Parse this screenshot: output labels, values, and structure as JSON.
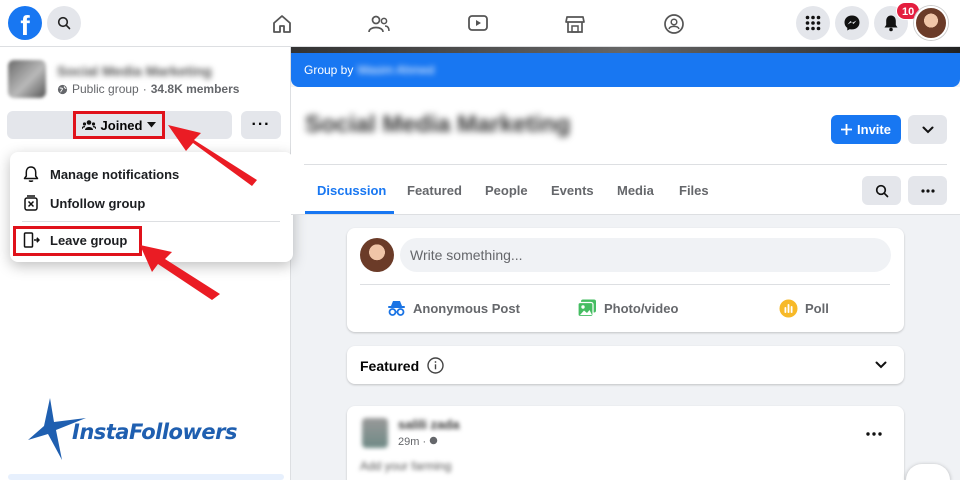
{
  "topbar": {
    "logo": "f",
    "notification_count": "10",
    "icons": [
      "search-icon",
      "home-icon",
      "friends-icon",
      "watch-icon",
      "marketplace-icon",
      "groups-icon",
      "menu-grid-icon",
      "messenger-icon",
      "bell-icon"
    ]
  },
  "sidebar": {
    "group_name": "Social Media Marketing",
    "privacy": "Public group",
    "separator": "·",
    "members": "34.8K members",
    "joined_label": "Joined",
    "more_label": "···"
  },
  "dropdown": {
    "items": [
      {
        "label": "Manage notifications",
        "icon": "bell-outline-icon"
      },
      {
        "label": "Unfollow group",
        "icon": "unfollow-icon"
      },
      {
        "label": "Leave group",
        "icon": "leave-door-icon"
      }
    ]
  },
  "watermark": {
    "brand": "InstaFollowers"
  },
  "main": {
    "group_by_label": "Group by",
    "group_by_name": "Wasim Ahmed",
    "title": "Social Media Marketing",
    "invite_label": "Invite",
    "tabs": [
      "Discussion",
      "Featured",
      "People",
      "Events",
      "Media",
      "Files"
    ],
    "active_tab": "Discussion",
    "composer": {
      "placeholder": "Write something...",
      "actions": [
        {
          "label": "Anonymous Post",
          "icon": "anonymous-icon",
          "color": "#1b74e4"
        },
        {
          "label": "Photo/video",
          "icon": "photo-icon",
          "color": "#45bd62"
        },
        {
          "label": "Poll",
          "icon": "poll-icon",
          "color": "#f7b928"
        }
      ]
    },
    "featured": {
      "title": "Featured"
    },
    "post": {
      "author": "salili zada",
      "time": "29m",
      "text": "Add your farming"
    }
  },
  "colors": {
    "accent": "#1877f2",
    "highlight_red": "#e0121b",
    "badge_red": "#e41e3f"
  }
}
